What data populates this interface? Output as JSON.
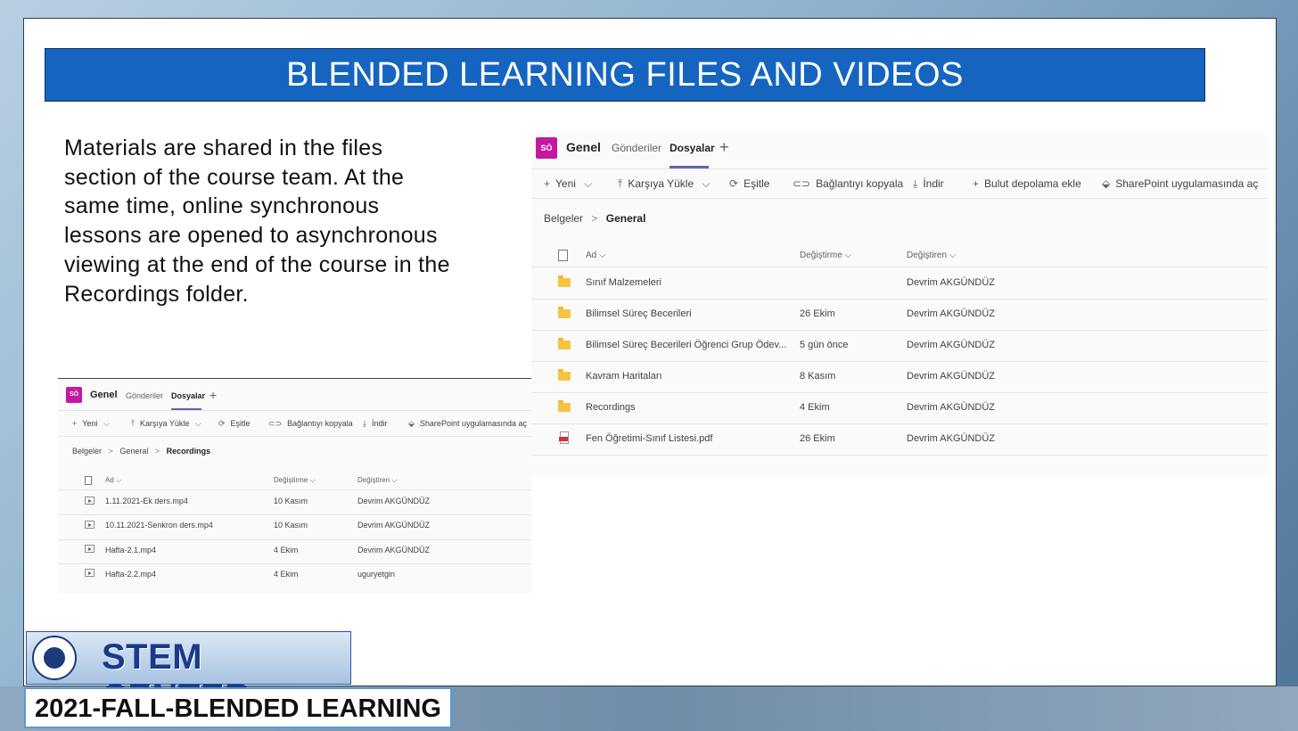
{
  "slide": {
    "title": "BLENDED LEARNING FILES AND VIDEOS",
    "body": "Materials are shared in the files section of the course team. At the same time, online synchronous lessons are opened to asynchronous viewing at the end of the course in the Recordings folder."
  },
  "logo": {
    "stem_text": "STEM CENTER",
    "footer_text": "2021-FALL-BLENDED LEARNING"
  },
  "teams_main": {
    "avatar": "SÖ",
    "channel": "Genel",
    "tabs": [
      "Gönderiler",
      "Dosyalar"
    ],
    "add_tab": "+",
    "toolbar": {
      "new": "Yeni",
      "upload": "Karşıya Yükle",
      "sync": "Eşitle",
      "copy_link": "Bağlantıyı kopyala",
      "download": "İndir",
      "add_cloud": "Bulut depolama ekle",
      "sharepoint": "SharePoint uygulamasında aç"
    },
    "breadcrumb": {
      "root": "Belgeler",
      "current": "General"
    },
    "columns": {
      "name": "Ad",
      "modified": "Değiştirme",
      "modified_by": "Değiştiren"
    },
    "rows": [
      {
        "type": "shared-folder",
        "name": "Sınıf Malzemeleri",
        "modified": "",
        "by": "Devrim AKGÜNDÜZ"
      },
      {
        "type": "folder",
        "name": "Bilimsel Süreç Becerileri",
        "modified": "26 Ekim",
        "by": "Devrim AKGÜNDÜZ"
      },
      {
        "type": "folder",
        "name": "Bilimsel Süreç Becerileri Öğrenci Grup Ödev...",
        "modified": "5 gün önce",
        "by": "Devrim AKGÜNDÜZ"
      },
      {
        "type": "folder",
        "name": "Kavram Haritaları",
        "modified": "8 Kasım",
        "by": "Devrim AKGÜNDÜZ"
      },
      {
        "type": "folder",
        "name": "Recordings",
        "modified": "4 Ekim",
        "by": "Devrim AKGÜNDÜZ"
      },
      {
        "type": "pdf",
        "name": "Fen Öğretimi-Sınıf Listesi.pdf",
        "modified": "26 Ekim",
        "by": "Devrim AKGÜNDÜZ"
      }
    ]
  },
  "teams_rec": {
    "avatar": "SÖ",
    "channel": "Genel",
    "tabs": [
      "Gönderiler",
      "Dosyalar"
    ],
    "add_tab": "+",
    "toolbar": {
      "new": "Yeni",
      "upload": "Karşıya Yükle",
      "sync": "Eşitle",
      "copy_link": "Bağlantıyı kopyala",
      "download": "İndir",
      "sharepoint": "SharePoint uygulamasında aç"
    },
    "breadcrumb": {
      "root": "Belgeler",
      "mid": "General",
      "current": "Recordings"
    },
    "columns": {
      "name": "Ad",
      "modified": "Değiştirme",
      "modified_by": "Değiştiren"
    },
    "rows": [
      {
        "type": "video",
        "name": "1.11.2021-Ek ders.mp4",
        "modified": "10 Kasım",
        "by": "Devrim AKGÜNDÜZ"
      },
      {
        "type": "video",
        "name": "10.11.2021-Senkron ders.mp4",
        "modified": "10 Kasım",
        "by": "Devrim AKGÜNDÜZ"
      },
      {
        "type": "video",
        "name": "Hafta-2.1.mp4",
        "modified": "4 Ekim",
        "by": "Devrim AKGÜNDÜZ"
      },
      {
        "type": "video",
        "name": "Hafta-2.2.mp4",
        "modified": "4 Ekim",
        "by": "uguryetgin"
      }
    ]
  }
}
